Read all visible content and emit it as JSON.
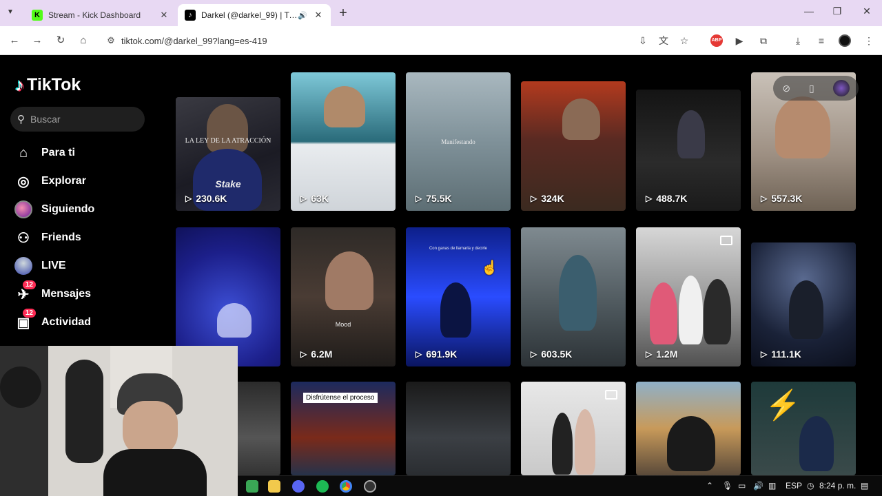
{
  "browser": {
    "tabs": [
      {
        "title": "Stream - Kick Dashboard",
        "favicon": "K"
      },
      {
        "title": "Darkel (@darkel_99) | TikTok",
        "favicon": "♪"
      }
    ],
    "url": "tiktok.com/@darkel_99?lang=es-419"
  },
  "sidebar": {
    "logo": "TikTok",
    "search_placeholder": "Buscar",
    "items": [
      {
        "label": "Para ti",
        "icon": "home-icon"
      },
      {
        "label": "Explorar",
        "icon": "compass-icon"
      },
      {
        "label": "Siguiendo",
        "icon": "following-avatar-icon"
      },
      {
        "label": "Friends",
        "icon": "friends-icon"
      },
      {
        "label": "LIVE",
        "icon": "live-icon"
      },
      {
        "label": "Mensajes",
        "icon": "messages-icon",
        "badge": "12"
      },
      {
        "label": "Actividad",
        "icon": "inbox-icon",
        "badge": "12"
      }
    ]
  },
  "videos": [
    {
      "views": "230.6K",
      "caption": "LA LEY DE LA ATRACCIÓN",
      "overlay": "Stake"
    },
    {
      "views": "63K"
    },
    {
      "views": "75.5K",
      "caption": "Manifestando"
    },
    {
      "views": "324K"
    },
    {
      "views": "488.7K"
    },
    {
      "views": "557.3K"
    },
    {
      "views": ""
    },
    {
      "views": "6.2M",
      "caption": "Mood"
    },
    {
      "views": "691.9K",
      "caption": "Con ganas de llamarla y decirle"
    },
    {
      "views": "603.5K"
    },
    {
      "views": "1.2M"
    },
    {
      "views": "111.1K"
    },
    {
      "views": ""
    },
    {
      "views": "",
      "sticker": "Disfrútense el proceso"
    },
    {
      "views": ""
    },
    {
      "views": ""
    },
    {
      "views": ""
    },
    {
      "views": ""
    }
  ],
  "taskbar": {
    "lang": "ESP",
    "time": "8:24 p. m."
  }
}
